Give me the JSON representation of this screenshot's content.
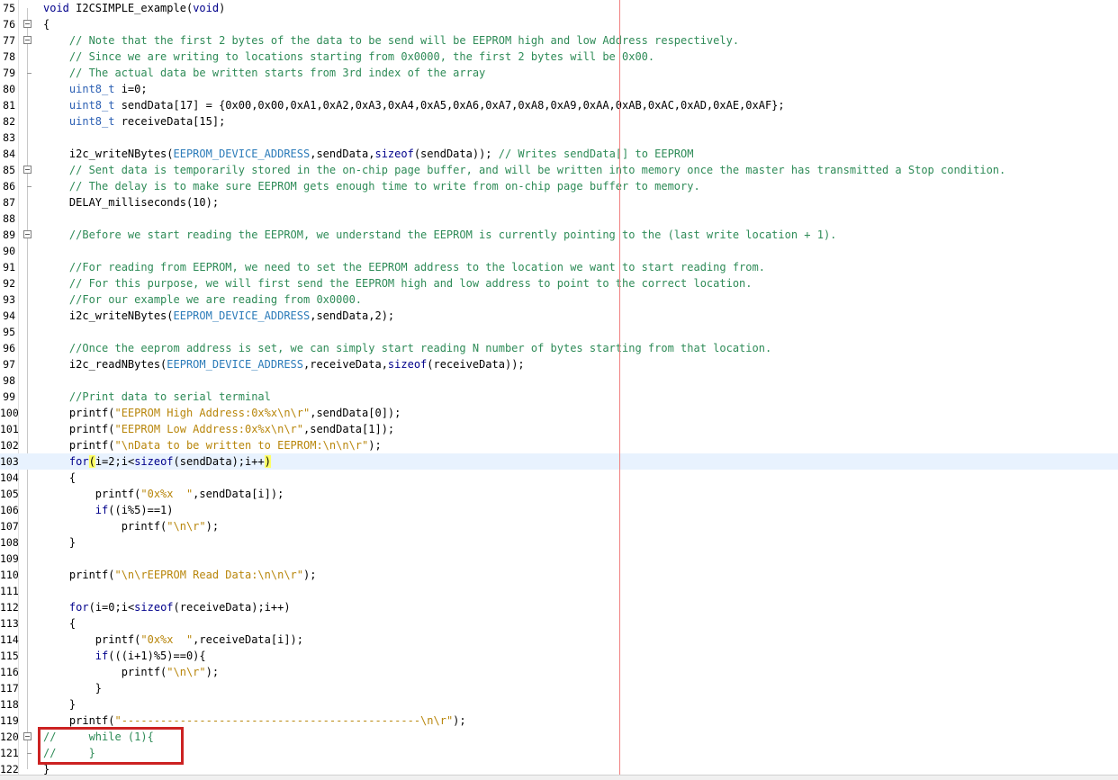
{
  "editor": {
    "highlight_color": "#cc2222",
    "current_line": "103",
    "lines": [
      {
        "n": "75",
        "code": "void I2CSIMPLE_example(void)"
      },
      {
        "n": "76",
        "code": "{"
      },
      {
        "n": "77",
        "code": "    // Note that the first 2 bytes of the data to be send will be EEPROM high and low Address respectively."
      },
      {
        "n": "78",
        "code": "    // Since we are writing to locations starting from 0x0000, the first 2 bytes will be 0x00."
      },
      {
        "n": "79",
        "code": "    // The actual data be written starts from 3rd index of the array"
      },
      {
        "n": "80",
        "code": "    uint8_t i=0;"
      },
      {
        "n": "81",
        "code": "    uint8_t sendData[17] = {0x00,0x00,0xA1,0xA2,0xA3,0xA4,0xA5,0xA6,0xA7,0xA8,0xA9,0xAA,0xAB,0xAC,0xAD,0xAE,0xAF};"
      },
      {
        "n": "82",
        "code": "    uint8_t receiveData[15];"
      },
      {
        "n": "83",
        "code": ""
      },
      {
        "n": "84",
        "code": "    i2c_writeNBytes(EEPROM_DEVICE_ADDRESS,sendData,sizeof(sendData)); // Writes sendData[] to EEPROM"
      },
      {
        "n": "85",
        "code": "    // Sent data is temporarily stored in the on-chip page buffer, and will be written into memory once the master has transmitted a Stop condition."
      },
      {
        "n": "86",
        "code": "    // The delay is to make sure EEPROM gets enough time to write from on-chip page buffer to memory."
      },
      {
        "n": "87",
        "code": "    DELAY_milliseconds(10);"
      },
      {
        "n": "88",
        "code": ""
      },
      {
        "n": "89",
        "code": "    //Before we start reading the EEPROM, we understand the EEPROM is currently pointing to the (last write location + 1)."
      },
      {
        "n": "90",
        "code": ""
      },
      {
        "n": "91",
        "code": "    //For reading from EEPROM, we need to set the EEPROM address to the location we want to start reading from."
      },
      {
        "n": "92",
        "code": "    // For this purpose, we will first send the EEPROM high and low address to point to the correct location."
      },
      {
        "n": "93",
        "code": "    //For our example we are reading from 0x0000."
      },
      {
        "n": "94",
        "code": "    i2c_writeNBytes(EEPROM_DEVICE_ADDRESS,sendData,2);"
      },
      {
        "n": "95",
        "code": ""
      },
      {
        "n": "96",
        "code": "    //Once the eeprom address is set, we can simply start reading N number of bytes starting from that location."
      },
      {
        "n": "97",
        "code": "    i2c_readNBytes(EEPROM_DEVICE_ADDRESS,receiveData,sizeof(receiveData));"
      },
      {
        "n": "98",
        "code": ""
      },
      {
        "n": "99",
        "code": "    //Print data to serial terminal"
      },
      {
        "n": "100",
        "code": "    printf(\"EEPROM High Address:0x%x\\n\\r\",sendData[0]);"
      },
      {
        "n": "101",
        "code": "    printf(\"EEPROM Low Address:0x%x\\n\\r\",sendData[1]);"
      },
      {
        "n": "102",
        "code": "    printf(\"\\nData to be written to EEPROM:\\n\\n\\r\");"
      },
      {
        "n": "103",
        "code": "    for(i=2;i<sizeof(sendData);i++)"
      },
      {
        "n": "104",
        "code": "    {"
      },
      {
        "n": "105",
        "code": "        printf(\"0x%x  \",sendData[i]);"
      },
      {
        "n": "106",
        "code": "        if((i%5)==1)"
      },
      {
        "n": "107",
        "code": "            printf(\"\\n\\r\");"
      },
      {
        "n": "108",
        "code": "    }"
      },
      {
        "n": "109",
        "code": ""
      },
      {
        "n": "110",
        "code": "    printf(\"\\n\\rEEPROM Read Data:\\n\\n\\r\");"
      },
      {
        "n": "111",
        "code": ""
      },
      {
        "n": "112",
        "code": "    for(i=0;i<sizeof(receiveData);i++)"
      },
      {
        "n": "113",
        "code": "    {"
      },
      {
        "n": "114",
        "code": "        printf(\"0x%x  \",receiveData[i]);"
      },
      {
        "n": "115",
        "code": "        if(((i+1)%5)==0){"
      },
      {
        "n": "116",
        "code": "            printf(\"\\n\\r\");"
      },
      {
        "n": "117",
        "code": "        }"
      },
      {
        "n": "118",
        "code": "    }"
      },
      {
        "n": "119",
        "code": "    printf(\"----------------------------------------------\\n\\r\");"
      },
      {
        "n": "120",
        "code": "//     while (1){"
      },
      {
        "n": "121",
        "code": "//     }"
      },
      {
        "n": "122",
        "code": "}"
      }
    ]
  }
}
